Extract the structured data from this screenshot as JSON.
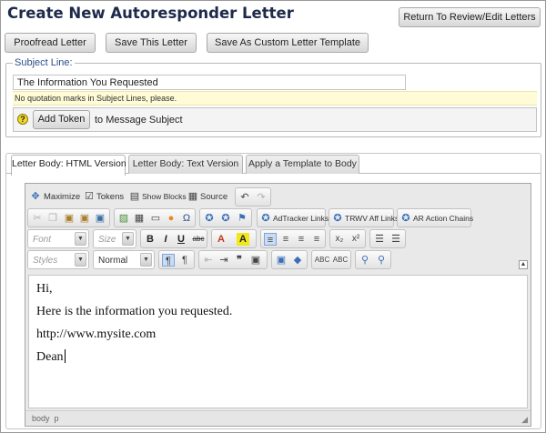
{
  "page": {
    "title": "Create New Autoresponder Letter"
  },
  "actions": {
    "return_label": "Return To Review/Edit Letters",
    "proofread_label": "Proofread Letter",
    "save_label": "Save This Letter",
    "save_template_label": "Save As Custom Letter Template"
  },
  "subject": {
    "legend": "Subject Line:",
    "value": "The Information You Requested",
    "hint": "No quotation marks in Subject Lines, please.",
    "help_glyph": "?",
    "add_token_label": "Add Token",
    "token_suffix": "to Message Subject"
  },
  "tabs": [
    {
      "label": "Letter Body: HTML Version",
      "active": true
    },
    {
      "label": "Letter Body: Text Version",
      "active": false
    },
    {
      "label": "Apply a Template to Body",
      "active": false
    }
  ],
  "toolbar": {
    "maximize": "Maximize",
    "tokens": "Tokens",
    "show_blocks": "Show Blocks",
    "source": "Source",
    "adtracker": "AdTracker Links",
    "trwv": "TRWV Aff Links",
    "ar_chains": "AR Action Chains",
    "font_placeholder": "Font",
    "size_placeholder": "Size",
    "styles_placeholder": "Styles",
    "format_value": "Normal",
    "bold": "B",
    "italic": "I",
    "underline": "U",
    "strike": "abc"
  },
  "editor_body": {
    "lines": [
      "Hi,",
      "Here is the information you requested.",
      "http://www.mysite.com",
      "Dean"
    ]
  },
  "status_path": "body  p",
  "colors": {
    "title": "#1d2a4a",
    "legend": "#2a4f8a",
    "hint_bg": "#fefbd6"
  }
}
